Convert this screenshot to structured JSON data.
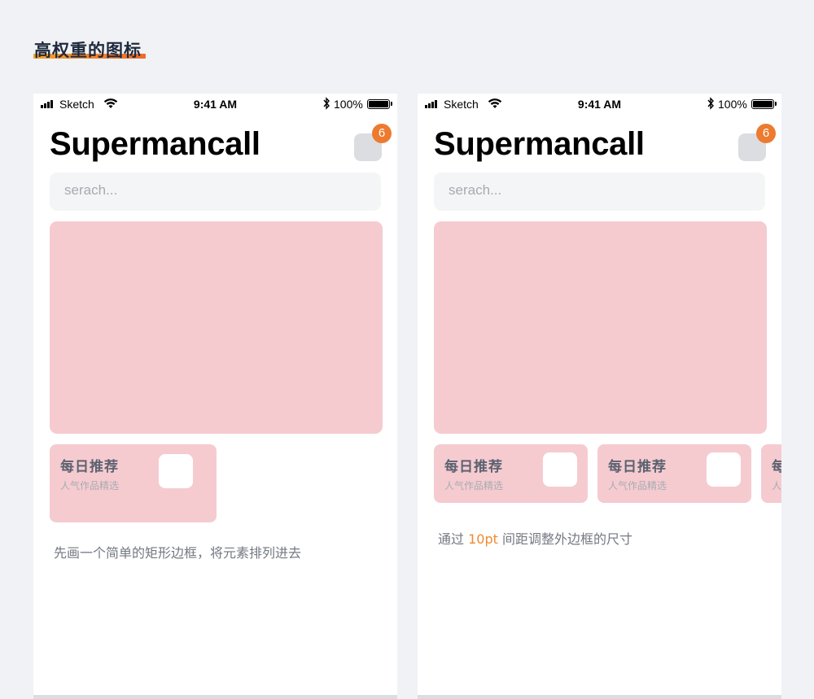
{
  "heading": "高权重的图标",
  "status_bar": {
    "carrier": "Sketch",
    "time": "9:41 AM",
    "battery": "100%"
  },
  "app": {
    "title": "Supermancall",
    "badge_count": "6",
    "search_placeholder": "serach..."
  },
  "card": {
    "title": "每日推荐",
    "subtitle": "人气作品精选"
  },
  "left_panel": {
    "caption": "先画一个简单的矩形边框，将元素排列进去"
  },
  "right_panel": {
    "caption_before": "通过 ",
    "caption_highlight": "10pt",
    "caption_after": " 间距调整外边框的尺寸",
    "partial_card_title": "每",
    "partial_card_subtitle": "人"
  },
  "colors": {
    "background": "#f1f2f6",
    "card_pink": "#f5cbd0",
    "badge_orange": "#ed7a2f",
    "highlight_orange": "#ef8a2e"
  },
  "icons": [
    "signal-icon",
    "wifi-icon",
    "bluetooth-icon",
    "battery-icon"
  ]
}
